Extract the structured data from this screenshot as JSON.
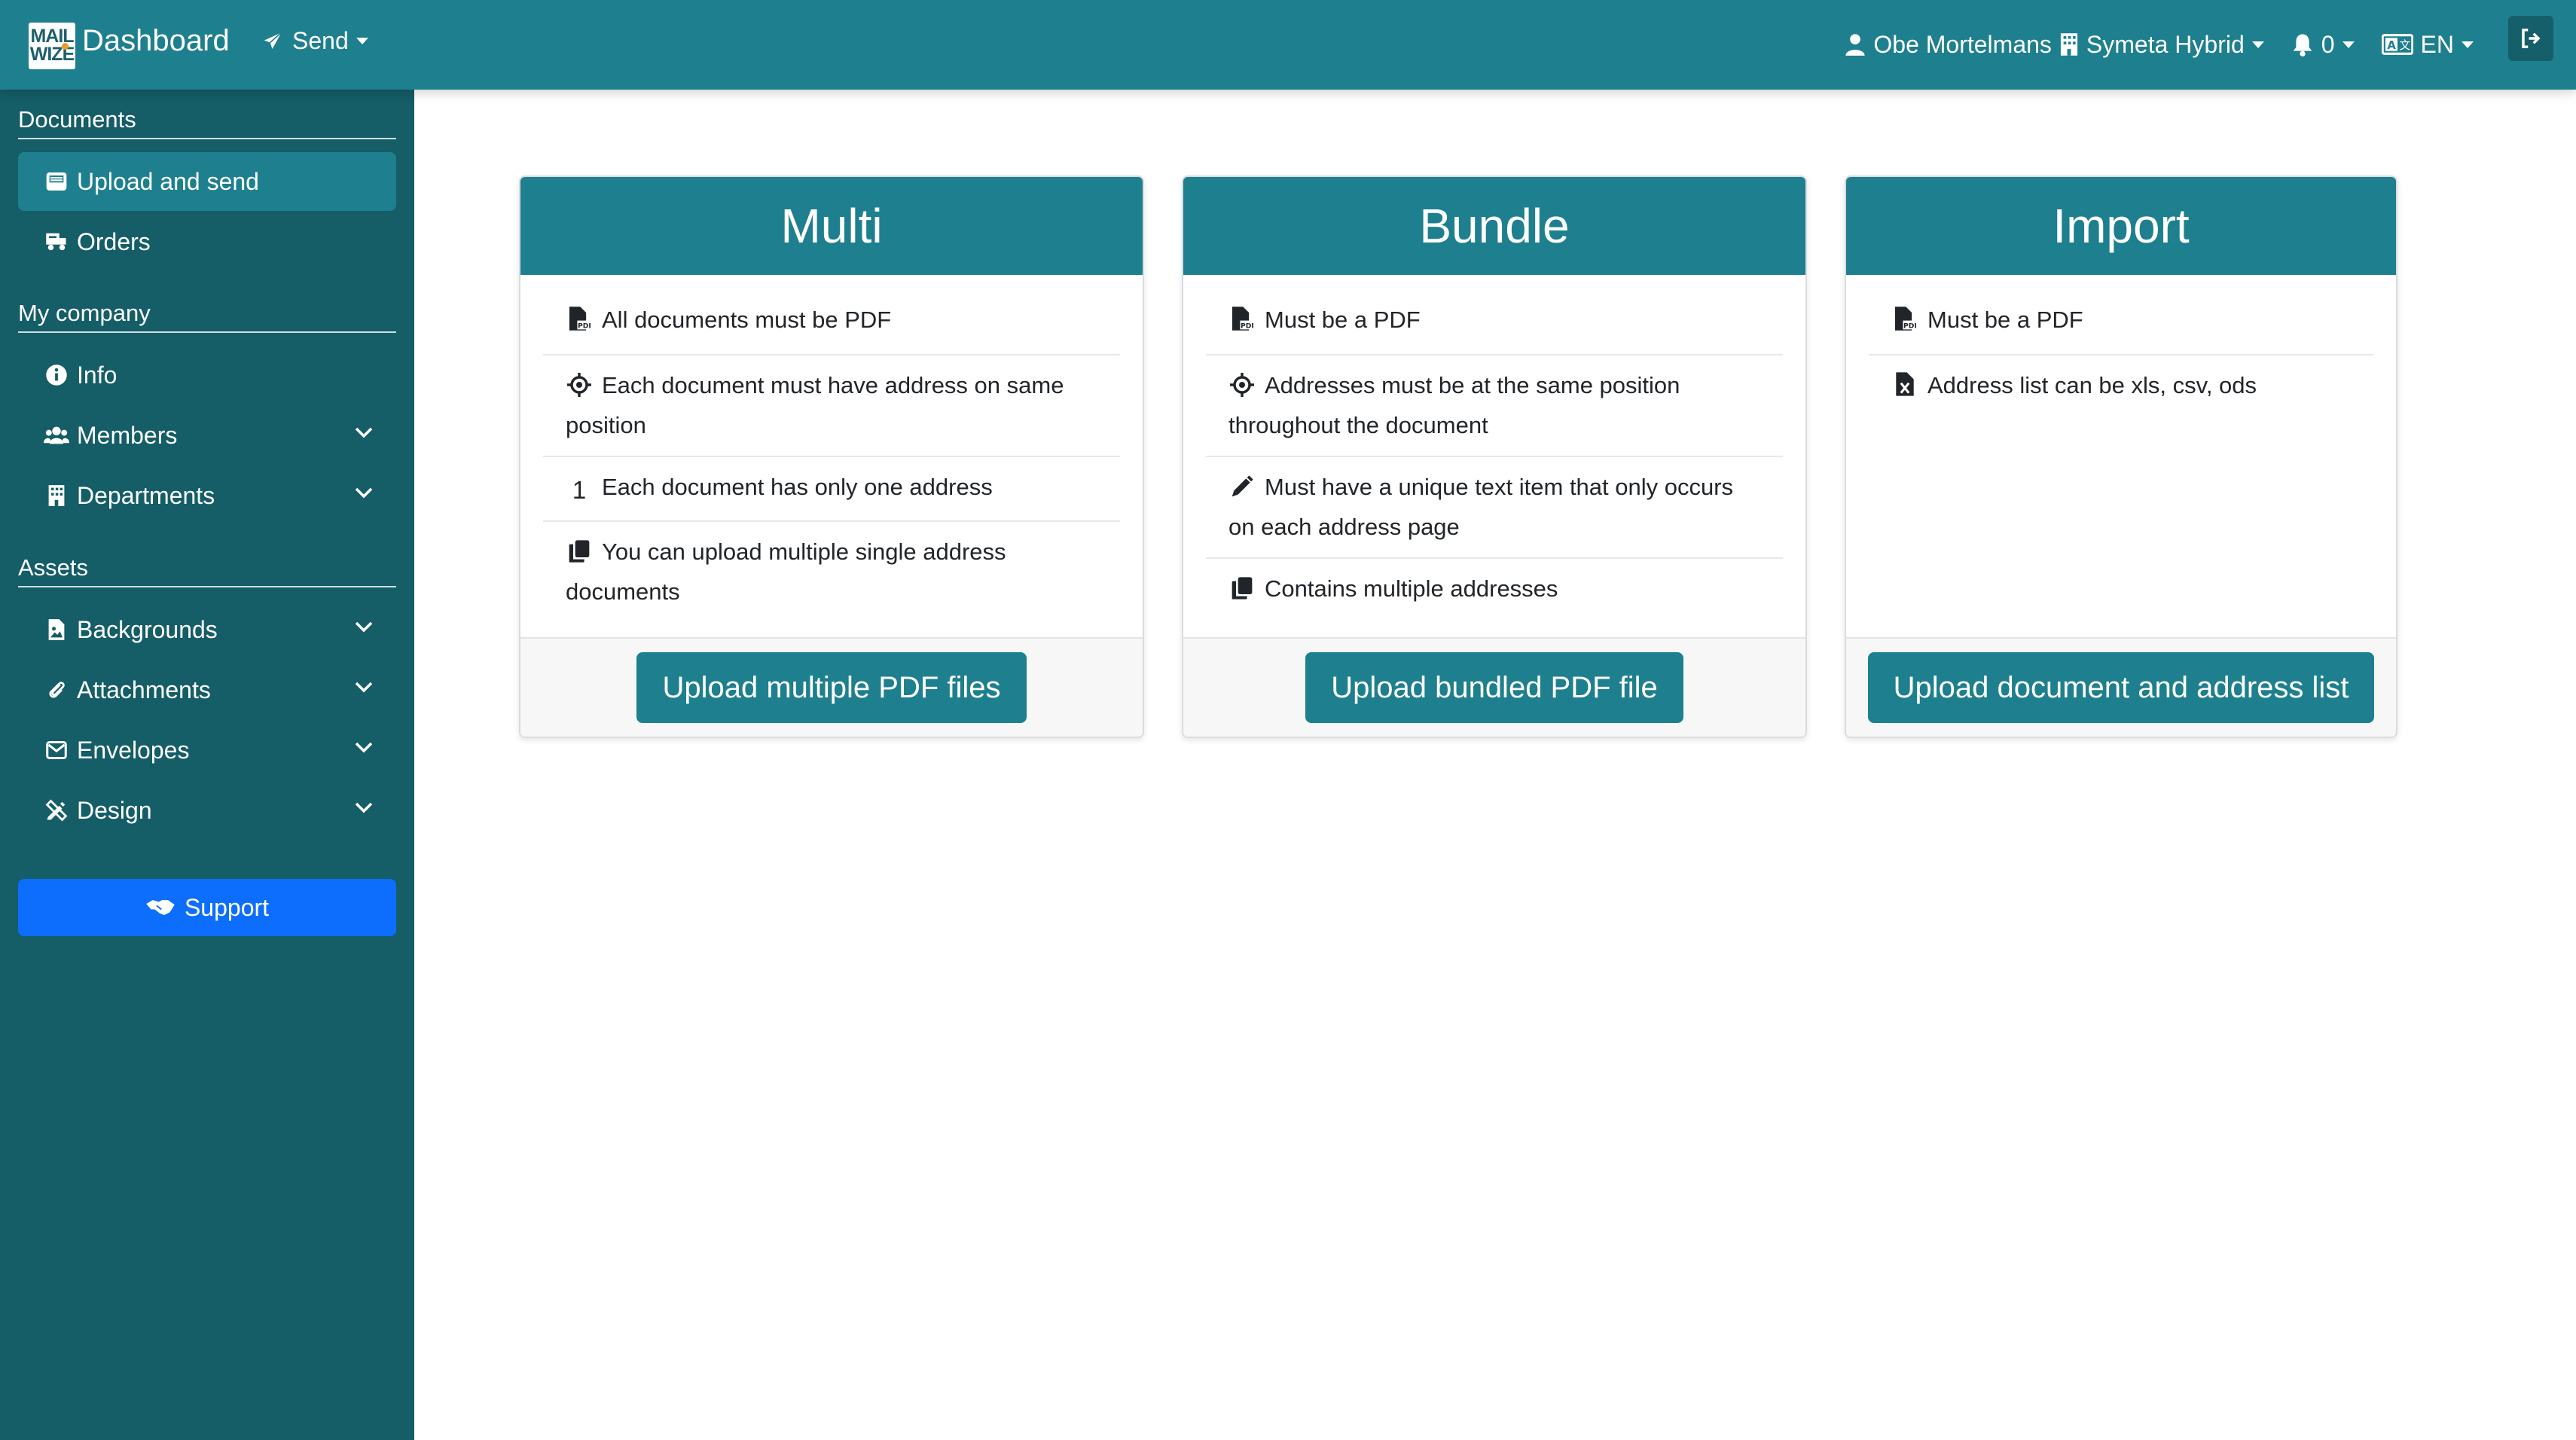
{
  "navbar": {
    "logo_top": "MAIL",
    "logo_bottom": "WIZE",
    "title": "Dashboard",
    "send_label": "Send",
    "user_name": "Obe Mortelmans",
    "company_name": "Symeta Hybrid",
    "notifications_count": "0",
    "language": "EN"
  },
  "sidebar": {
    "sections": {
      "documents": "Documents",
      "my_company": "My company",
      "assets": "Assets"
    },
    "items": {
      "upload_and_send": "Upload and send",
      "orders": "Orders",
      "info": "Info",
      "members": "Members",
      "departments": "Departments",
      "backgrounds": "Backgrounds",
      "attachments": "Attachments",
      "envelopes": "Envelopes",
      "design": "Design"
    },
    "support_label": "Support"
  },
  "cards": {
    "multi": {
      "title": "Multi",
      "items": [
        "All documents must be PDF",
        "Each document must have address on same position",
        "Each document has only one address",
        "You can upload multiple single address documents"
      ],
      "button": "Upload multiple PDF files"
    },
    "bundle": {
      "title": "Bundle",
      "items": [
        "Must be a PDF",
        "Addresses must be at the same position throughout the document",
        "Must have a unique text item that only occurs on each address page",
        "Contains multiple addresses"
      ],
      "button": "Upload bundled PDF file"
    },
    "import": {
      "title": "Import",
      "items": [
        "Must be a PDF",
        "Address list can be xls, csv, ods"
      ],
      "button": "Upload document and address list"
    }
  },
  "colors": {
    "navbar": "#1e7f8e",
    "sidebar": "#155d67",
    "support": "#0d6efd",
    "card_header": "#1e7f8e"
  }
}
